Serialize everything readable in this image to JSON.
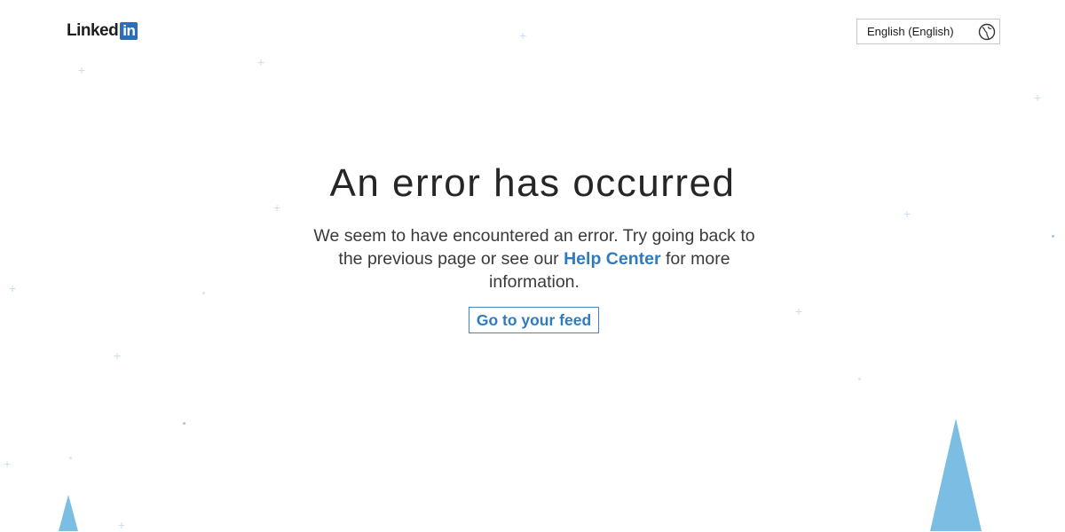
{
  "header": {
    "logo_text": "Linked",
    "logo_badge": "in",
    "language_selector": {
      "selected": "English (English)",
      "icon": "globe-icon"
    }
  },
  "main": {
    "title": "An error has occurred",
    "message_before": "We seem to have encountered an error. Try going back to the previous page or see our ",
    "help_link": "Help Center",
    "message_after": " for more information.",
    "feed_button": "Go to your feed"
  },
  "colors": {
    "accent": "#2f7bbf",
    "tree": "#7bbde3",
    "sparkle": "#c6e1f3"
  }
}
